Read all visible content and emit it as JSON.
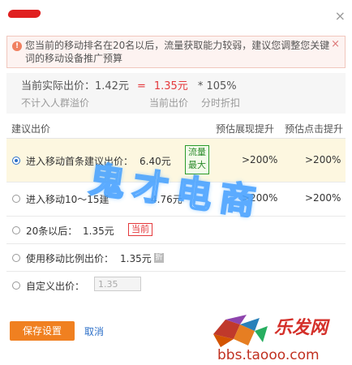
{
  "dialog": {
    "close_glyph": "×"
  },
  "warning": {
    "icon_glyph": "!",
    "text": "您当前的移动排名在20名以后，流量获取能力较弱，建议您调整您关键词的移动设备推广预算",
    "close_glyph": "×"
  },
  "summary": {
    "current_actual_label": "当前实际出价：1.42元",
    "equals": "=",
    "current_bid": "1.35元",
    "multiplier": "* 105%",
    "sub_labels": [
      "不计入人群溢价",
      "当前出价",
      "分时折扣"
    ]
  },
  "table": {
    "col_bid": "建议出价",
    "col_impr": "预估展现提升",
    "col_click": "预估点击提升"
  },
  "options": [
    {
      "label": "进入移动首条建议出价：",
      "price": "6.40元",
      "badge": "流量最大",
      "impr": ">200%",
      "click": ">200%",
      "selected": true
    },
    {
      "label": "进入移动10～15建",
      "price": "4.76元",
      "impr": ">200%",
      "click": ">200%",
      "selected": false
    },
    {
      "label": "20条以后：",
      "price": "1.35元",
      "badge": "当前",
      "selected": false
    },
    {
      "label": "使用移动比例出价：",
      "price": "1.35元",
      "badge": "折",
      "selected": false
    },
    {
      "label": "自定义出价：",
      "input_placeholder": "1.35",
      "selected": false
    }
  ],
  "footer": {
    "save_label": "保存设置",
    "cancel_label": "取消"
  },
  "watermark": {
    "text": "鬼才电商",
    "logo_text": "乐发网",
    "logo_url": "bbs.taooo.com"
  },
  "colors": {
    "accent_red": "#e4393c",
    "save_orange": "#f08020",
    "link_blue": "#2d70c8",
    "selected_row_bg": "#fdf7e0"
  }
}
